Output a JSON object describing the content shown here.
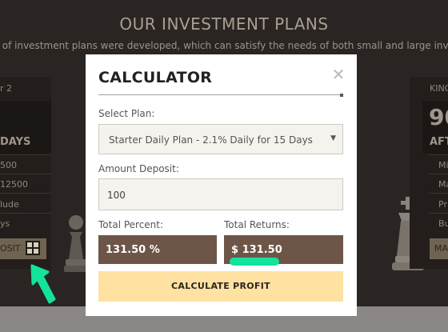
{
  "background": {
    "heading": "OUR INVESTMENT PLANS",
    "subtitle": "r of investment plans were developed, which can satisfy the needs of both small and large inv",
    "left_card": {
      "name_fragment": "r 2",
      "term_fragment": "DAYS",
      "rows": [
        "500",
        "12500",
        "lude",
        "ys"
      ],
      "button_fragment": "OSIT"
    },
    "right_card": {
      "name_fragment": "KING",
      "rate_fragment": "90",
      "term_fragment": "AFT",
      "rows": [
        "Mi",
        "Ma",
        "Pr",
        "Bu"
      ],
      "button_fragment": "MA"
    }
  },
  "modal": {
    "title": "CALCULATOR",
    "close_symbol": "✕",
    "select_plan_label": "Select Plan:",
    "selected_plan": "Starter Daily Plan - 2.1% Daily for 15 Days",
    "amount_label": "Amount Deposit:",
    "amount_value": "100",
    "total_percent_label": "Total Percent:",
    "total_percent_value": "131.50 %",
    "total_returns_label": "Total Returns:",
    "total_returns_value": "$ 131.50",
    "calculate_button": "CALCULATE PROFIT"
  },
  "colors": {
    "overlay_background": "#2a2522",
    "result_box": "#6d5648",
    "calculate_button": "#ffe2a2",
    "annotation": "#14e39b"
  },
  "icons": [
    "close-icon",
    "calculator-icon",
    "chess-pawn-icon",
    "chess-king-icon",
    "annotation-arrow-icon"
  ]
}
